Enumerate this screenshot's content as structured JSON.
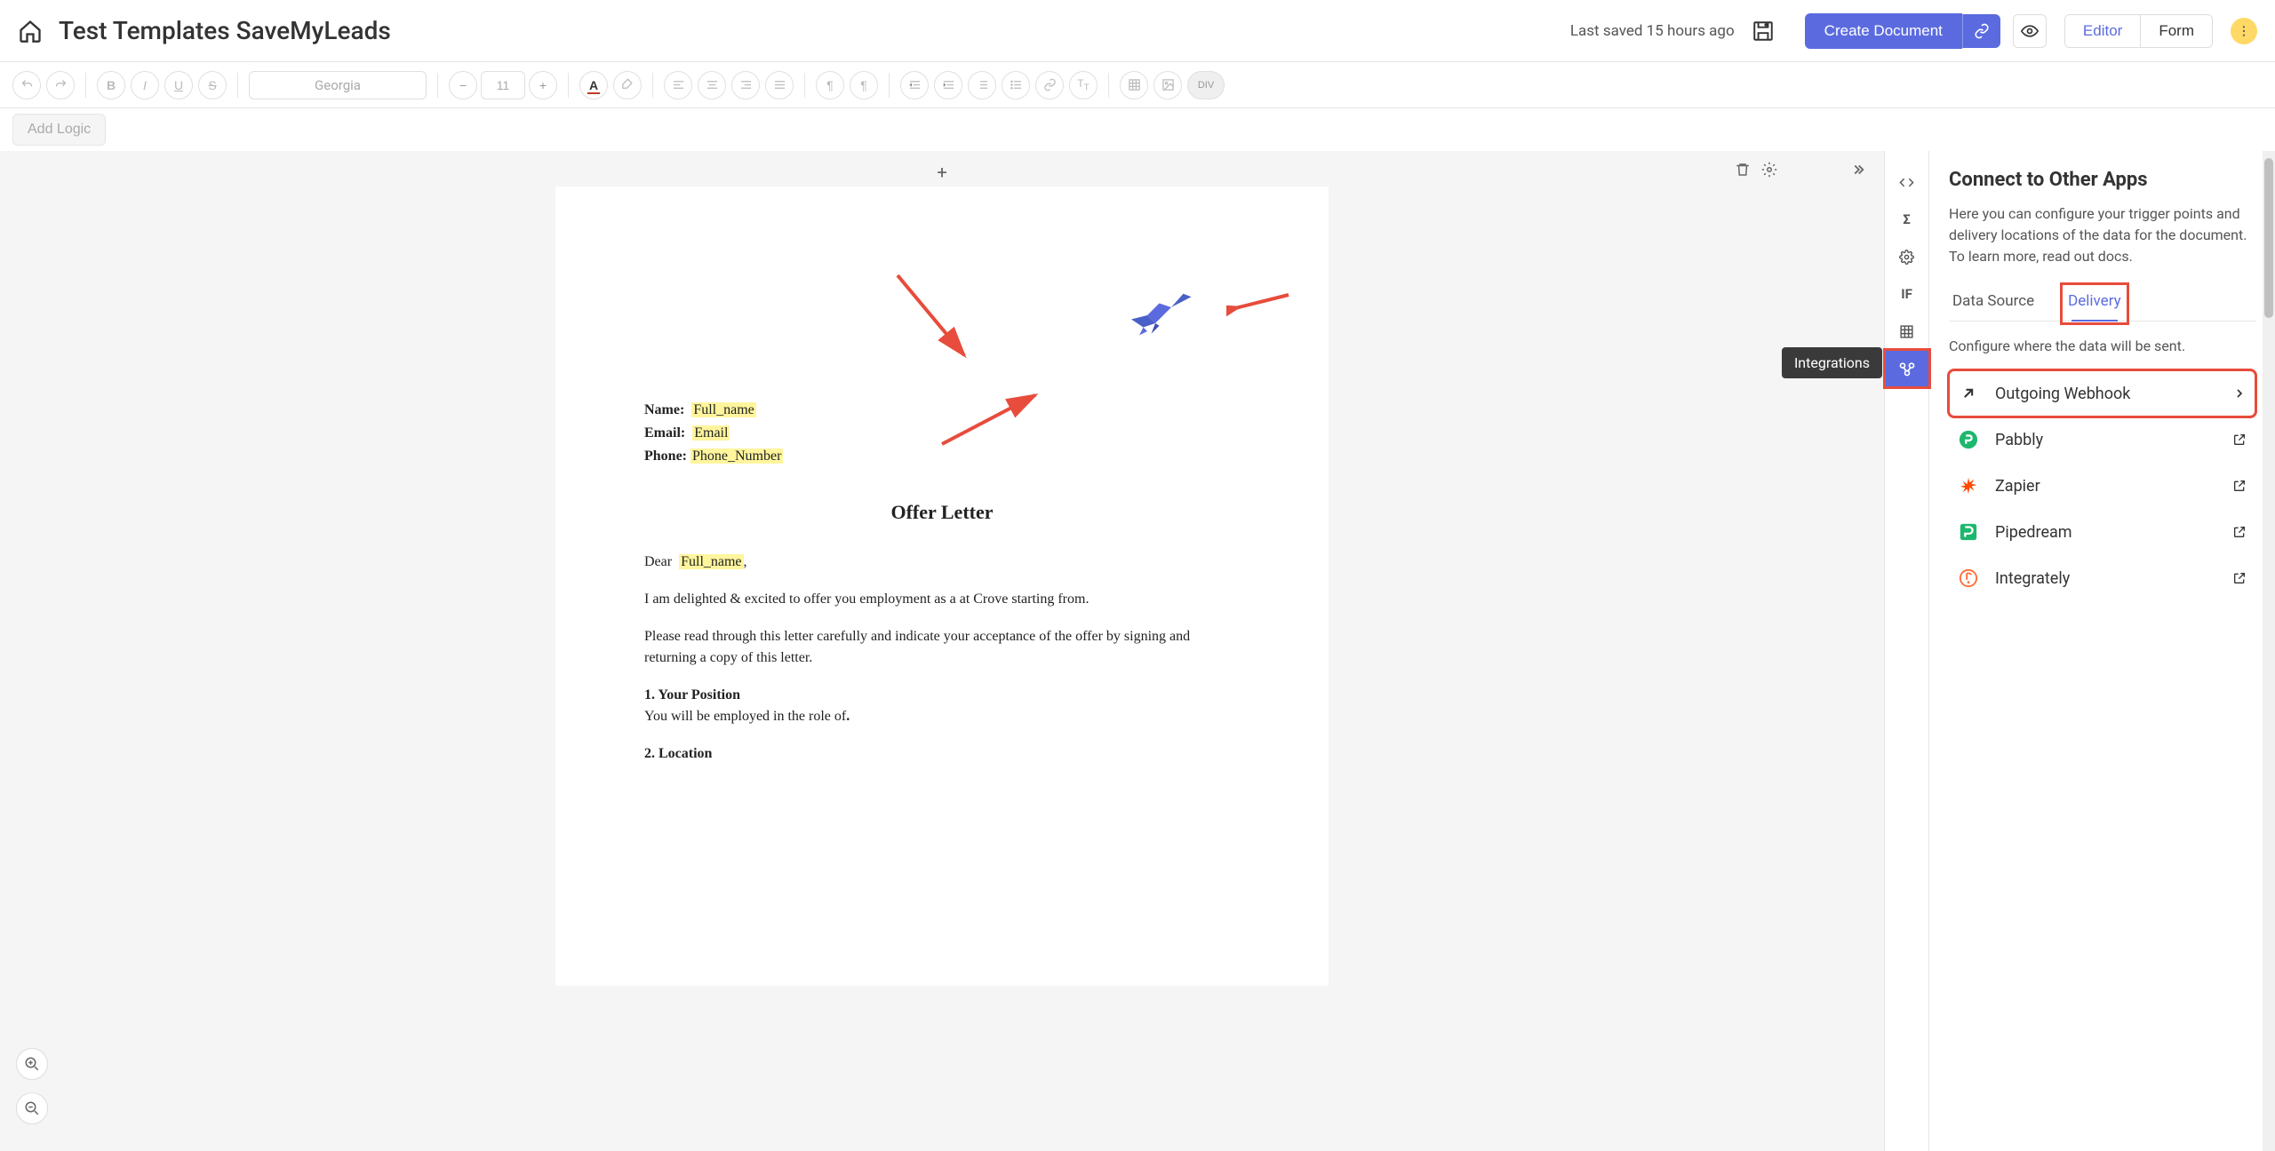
{
  "header": {
    "title": "Test Templates SaveMyLeads",
    "last_saved": "Last saved 15 hours ago",
    "create_document": "Create Document",
    "editor": "Editor",
    "form": "Form"
  },
  "toolbar": {
    "font_name": "Georgia",
    "font_size": "11",
    "add_logic": "Add Logic",
    "div_label": "DIV"
  },
  "rail": {
    "tooltip": "Integrations",
    "if_label": "IF"
  },
  "panel": {
    "title": "Connect to Other Apps",
    "description": "Here you can configure your trigger points and delivery locations of the data for the document. To learn more, read out docs.",
    "tabs": {
      "data_source": "Data Source",
      "delivery": "Delivery"
    },
    "configure_text": "Configure where the data will be sent.",
    "delivery_items": [
      {
        "label": "Outgoing Webhook",
        "icon": "arrow-out"
      },
      {
        "label": "Pabbly",
        "icon": "pabbly"
      },
      {
        "label": "Zapier",
        "icon": "zapier"
      },
      {
        "label": "Pipedream",
        "icon": "pipedream"
      },
      {
        "label": "Integrately",
        "icon": "integrately"
      }
    ]
  },
  "document": {
    "fields": {
      "name_label": "Name:",
      "name_value": "Full_name",
      "email_label": "Email:",
      "email_value": "Email",
      "phone_label": "Phone:",
      "phone_value": "Phone_Number"
    },
    "title": "Offer Letter",
    "greeting_prefix": "Dear",
    "greeting_name": "Full_name",
    "greeting_suffix": ",",
    "p1": "I am delighted & excited to offer you employment as a at Crove starting from.",
    "p2": "Please read through this letter carefully and indicate your acceptance of the offer by signing and returning a copy of this letter.",
    "sec1_head": "1. Your Position",
    "sec1_body": "You will be employed in the role of",
    "sec1_period": ".",
    "sec2_head": "2. Location"
  }
}
